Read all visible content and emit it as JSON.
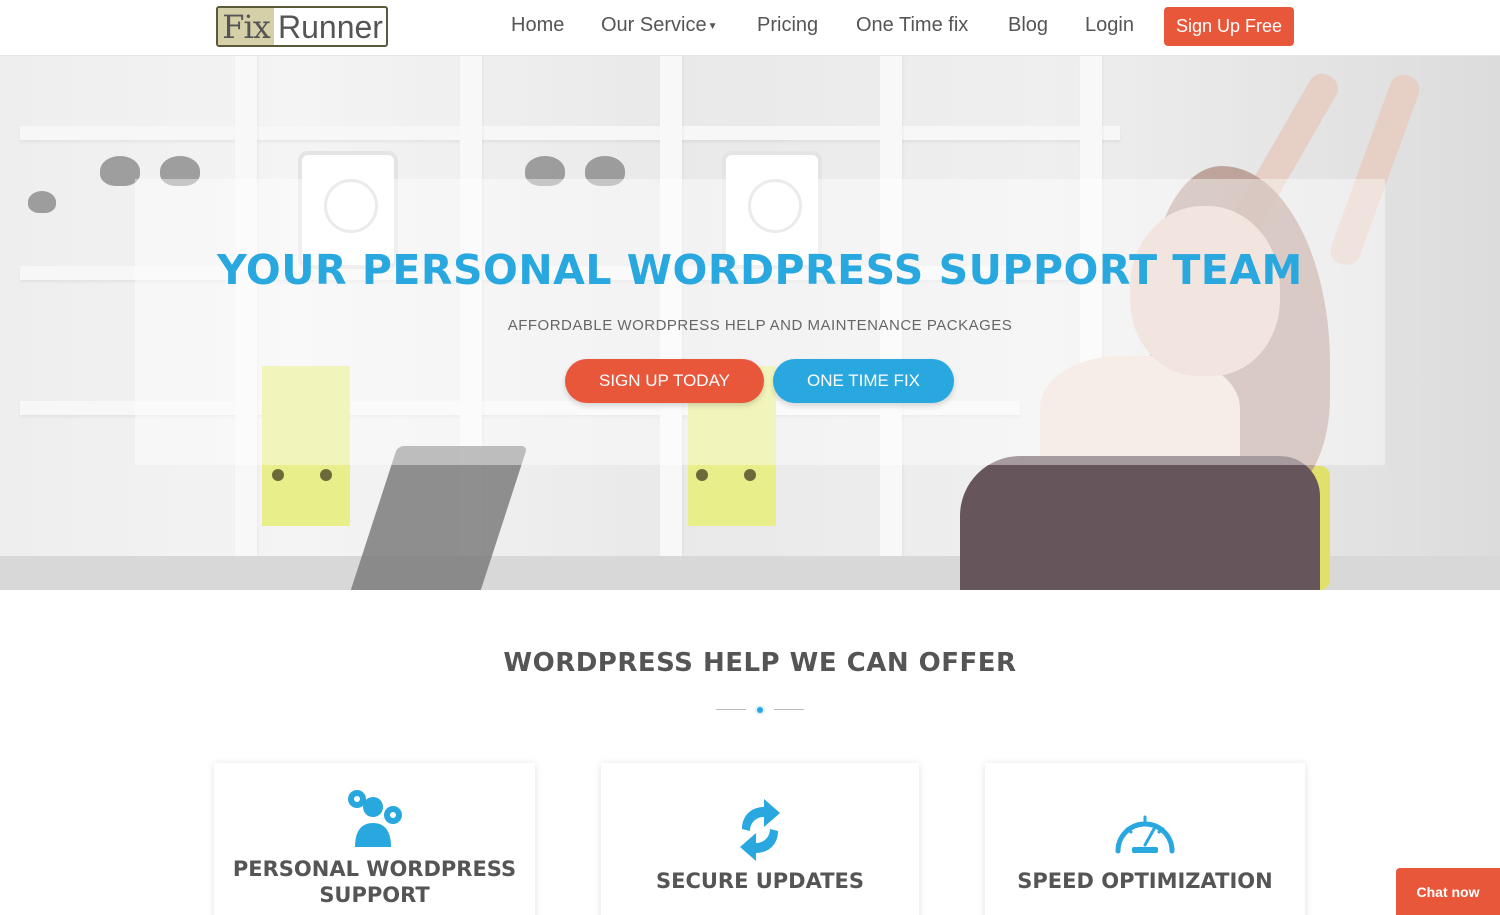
{
  "header": {
    "logo": {
      "part1": "Fix",
      "part2": "Runner"
    },
    "nav": [
      {
        "label": "Home"
      },
      {
        "label": "Our Service"
      },
      {
        "label": "Pricing"
      },
      {
        "label": "One Time fix"
      },
      {
        "label": "Blog"
      },
      {
        "label": "Login"
      }
    ],
    "cta_label": "Sign Up Free"
  },
  "hero": {
    "title": "YOUR PERSONAL WORDPRESS SUPPORT TEAM",
    "subtitle": "AFFORDABLE WORDPRESS HELP AND MAINTENANCE PACKAGES",
    "primary_button": "SIGN UP TODAY",
    "secondary_button": "ONE TIME FIX"
  },
  "services": {
    "title": "WORDPRESS HELP WE CAN OFFER",
    "cards": [
      {
        "title_line1": "PERSONAL WORDPRESS",
        "title_line2": "SUPPORT",
        "icon": "team-gears-icon"
      },
      {
        "title_line1": "SECURE UPDATES",
        "icon": "refresh-arrows-icon"
      },
      {
        "title_line1": "SPEED OPTIMIZATION",
        "icon": "speedometer-icon"
      }
    ]
  },
  "chat": {
    "label": "Chat now"
  },
  "colors": {
    "accent_orange": "#e9573a",
    "accent_blue": "#29a7df",
    "text": "#555555"
  }
}
